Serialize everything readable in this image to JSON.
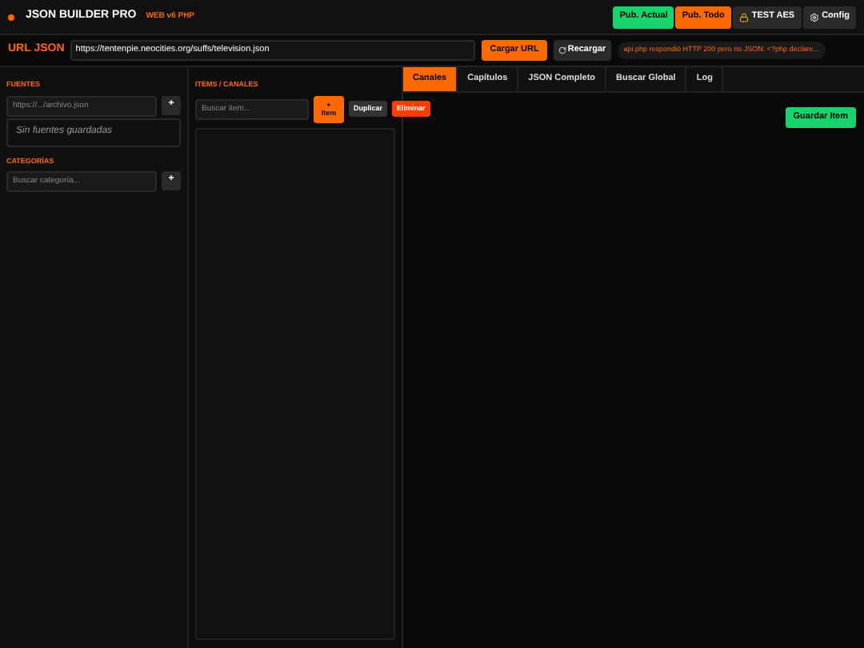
{
  "header": {
    "title": "JSON BUILDER PRO",
    "subtitle": "WEB v6 PHP",
    "buttons": [
      {
        "label": "Pub. Actual",
        "kind": "green"
      },
      {
        "label": "Pub. Todo",
        "kind": "orange"
      },
      {
        "label": "TEST AES",
        "kind": "lock"
      },
      {
        "label": "Config",
        "kind": "gear"
      }
    ]
  },
  "url_bar": {
    "label": "URL JSON",
    "value": "https://tentenpie.neocities.org/suffs/television.json",
    "load_button": "Cargar URL",
    "reload_button": "Recargar",
    "status": "api.php respondió HTTP 200 pero no JSON: <?php declare..."
  },
  "sources": {
    "title": "FUENTES",
    "placeholder": "https://.../archivo.json",
    "add_button": "+",
    "empty": "Sin fuentes guardadas"
  },
  "categories": {
    "title": "CATEGORÍAS",
    "placeholder": "Buscar categoría...",
    "add_button": "+"
  },
  "items": {
    "title": "ITEMS / CANALES",
    "placeholder": "Buscar item...",
    "new_button": [
      "+",
      "Item"
    ],
    "duplicate_button": "Duplicar",
    "delete_button": "Eliminar"
  },
  "tabs": [
    {
      "label": "Canales",
      "selected": true
    },
    {
      "label": "Capítulos",
      "selected": false
    },
    {
      "label": "JSON Completo",
      "selected": false
    },
    {
      "label": "Buscar Global",
      "selected": false
    },
    {
      "label": "Log",
      "selected": false
    }
  ],
  "save_button": "Guardar Item"
}
